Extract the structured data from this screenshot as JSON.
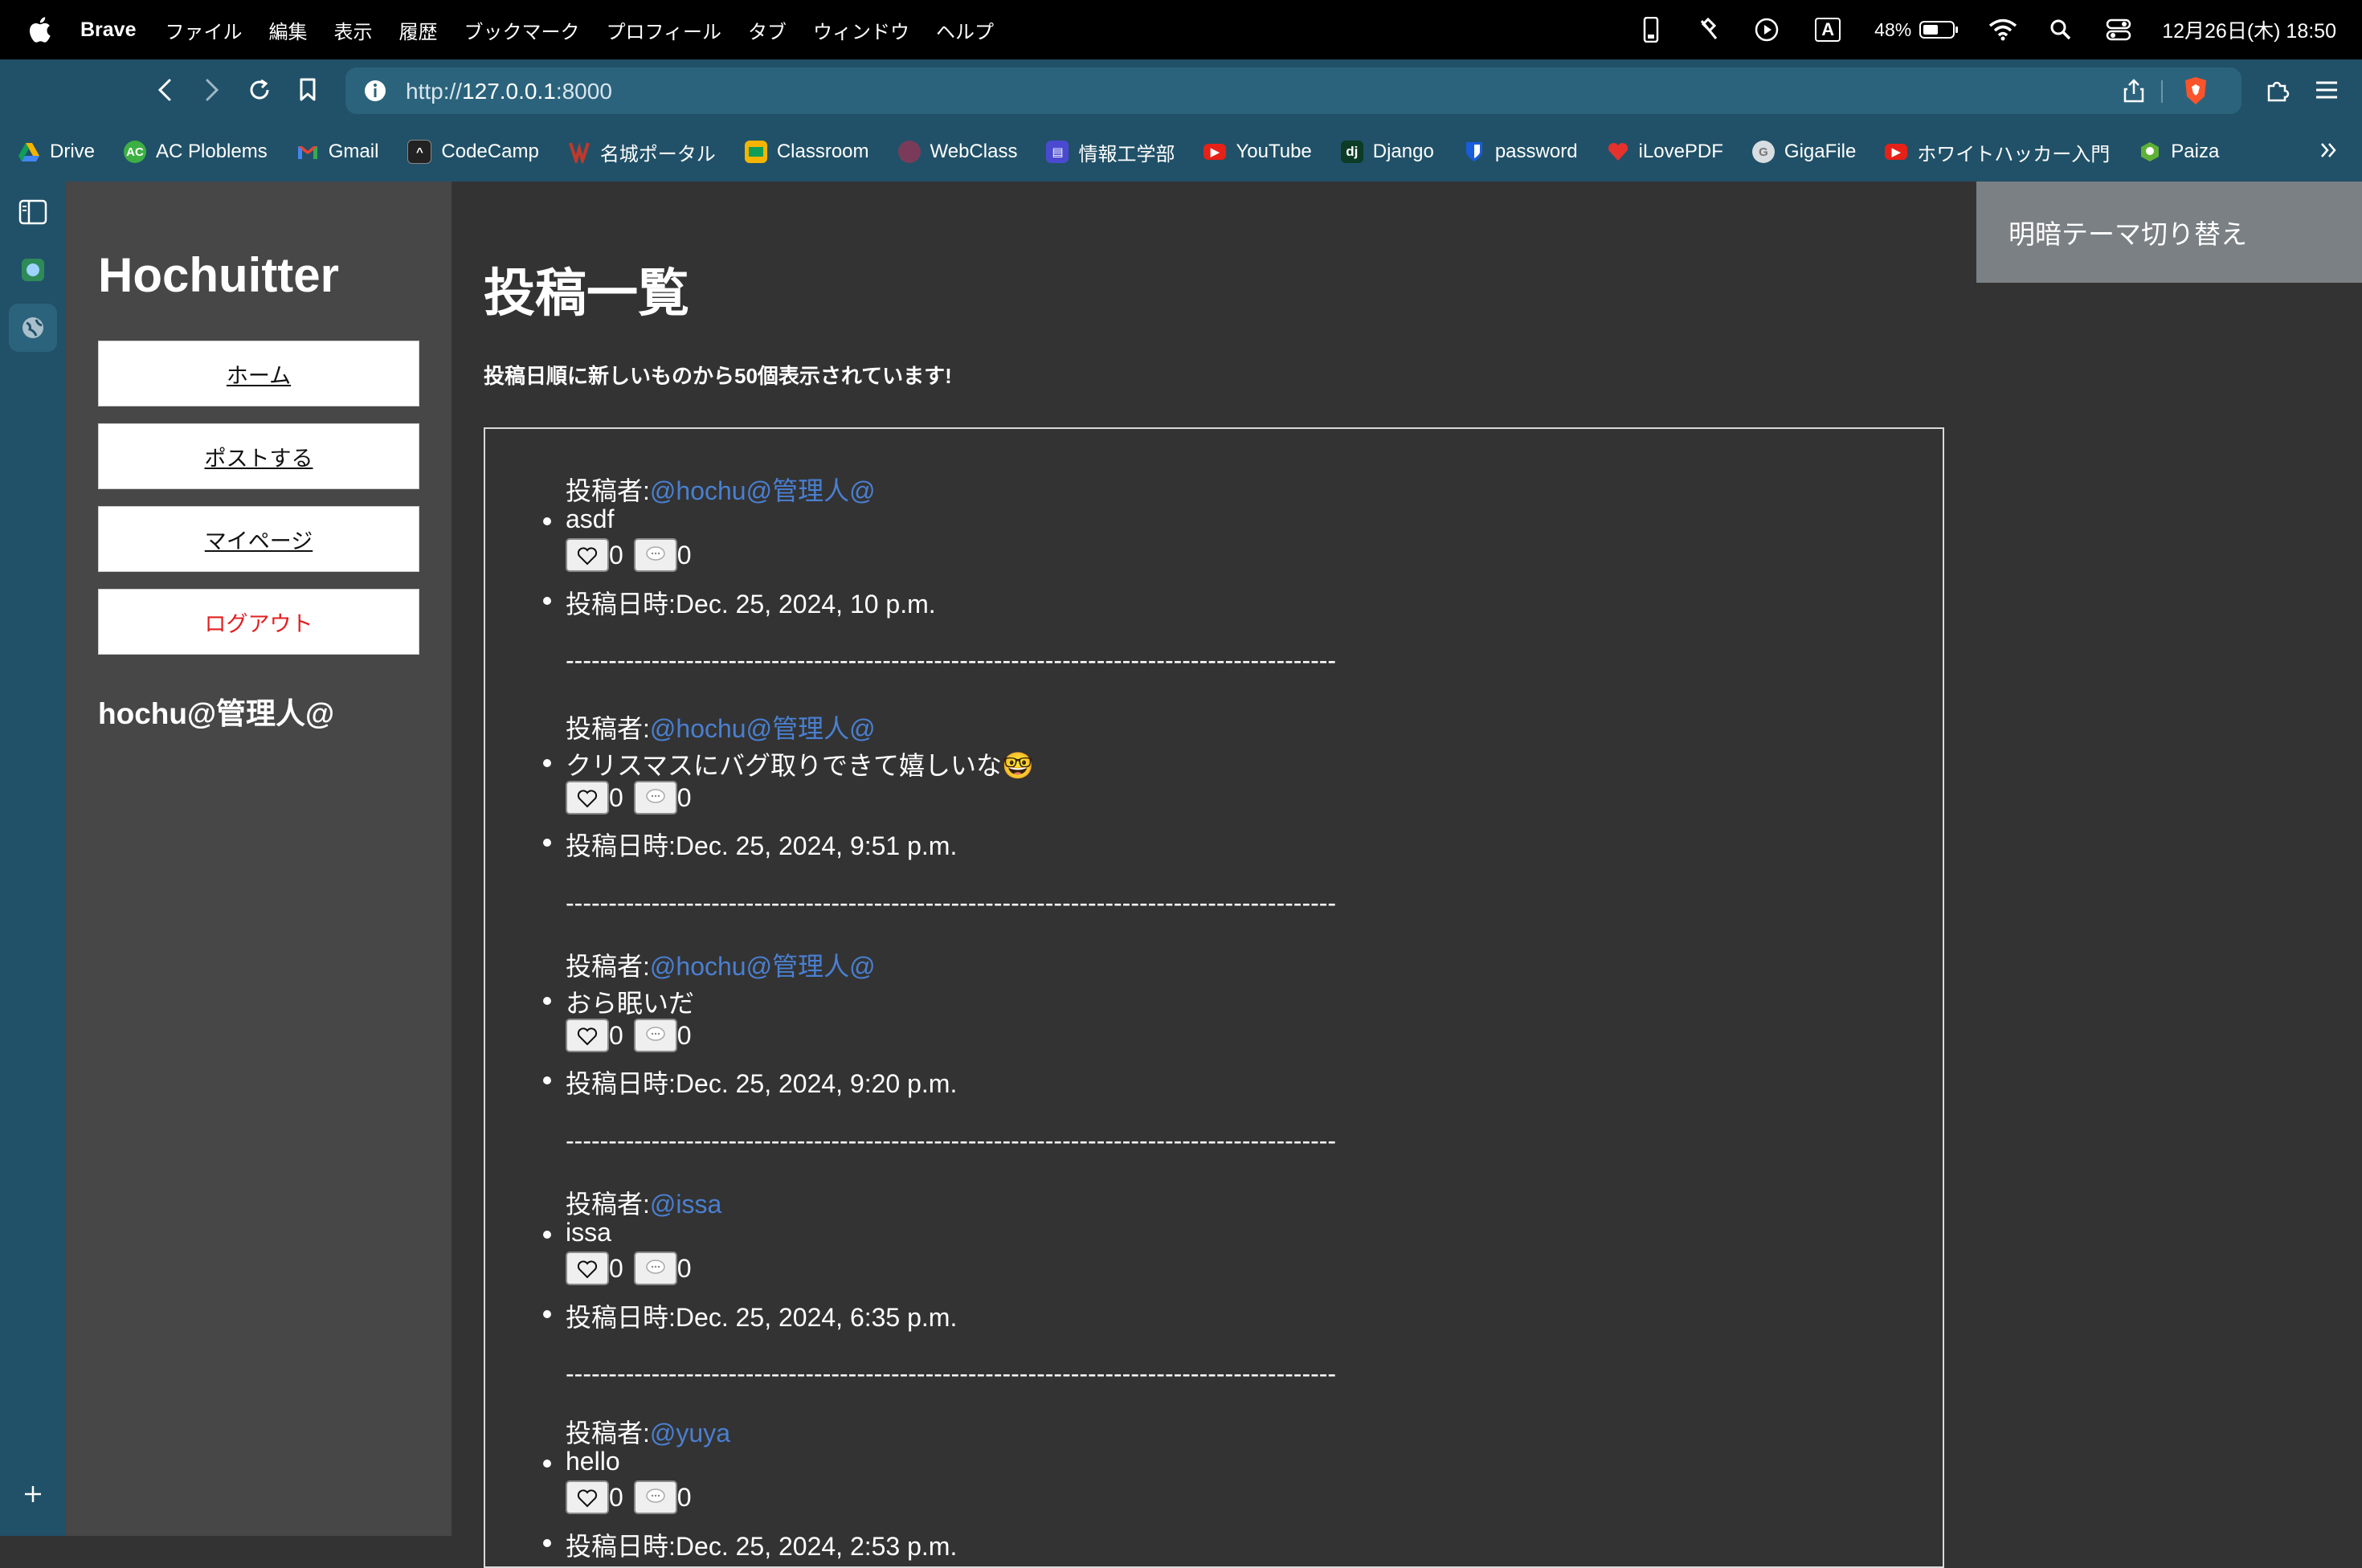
{
  "menubar": {
    "app_name": "Brave",
    "menus": [
      "ファイル",
      "編集",
      "表示",
      "履歴",
      "ブックマーク",
      "プロフィール",
      "タブ",
      "ウィンドウ",
      "ヘルプ"
    ],
    "battery": "48%",
    "datetime": "12月26日(木) 18:50",
    "input_indicator": "A"
  },
  "browser": {
    "url_prefix": "http://",
    "url_host": "127.0.0.1",
    "url_port": ":8000",
    "bookmarks": [
      {
        "label": "Drive",
        "icon": "drive-icon",
        "color": "#4285f4"
      },
      {
        "label": "AC Ploblems",
        "icon": "ac-icon",
        "color": "#3cb043"
      },
      {
        "label": "Gmail",
        "icon": "gmail-icon",
        "color": "#ea4335"
      },
      {
        "label": "CodeCamp",
        "icon": "codecamp-icon",
        "color": "#222222"
      },
      {
        "label": "名城ポータル",
        "icon": "meijo-icon",
        "color": "#c0392b"
      },
      {
        "label": "Classroom",
        "icon": "classroom-icon",
        "color": "#f4b400"
      },
      {
        "label": "WebClass",
        "icon": "webclass-icon",
        "color": "#7a3b5a"
      },
      {
        "label": "情報工学部",
        "icon": "info-eng-icon",
        "color": "#4a4ad0"
      },
      {
        "label": "YouTube",
        "icon": "youtube-icon",
        "color": "#e62117"
      },
      {
        "label": "Django",
        "icon": "django-icon",
        "color": "#0c3c26"
      },
      {
        "label": "password",
        "icon": "bitwarden-icon",
        "color": "#175ddc"
      },
      {
        "label": "iLovePDF",
        "icon": "ilovepdf-icon",
        "color": "#e5322d"
      },
      {
        "label": "GigaFile",
        "icon": "gigafile-icon",
        "color": "#9aa0a6"
      },
      {
        "label": "ホワイトハッカー入門",
        "icon": "youtube-icon",
        "color": "#e62117"
      },
      {
        "label": "Paiza",
        "icon": "paiza-icon",
        "color": "#5fb135"
      }
    ]
  },
  "site": {
    "title": "Hochuitter",
    "nav": {
      "home": "ホーム",
      "post": "ポストする",
      "mypage": "マイページ",
      "logout": "ログアウト"
    },
    "username": "hochu@管理人@",
    "theme_toggle": "明暗テーマ切り替え",
    "main_title": "投稿一覧",
    "subtitle": "投稿日順に新しいものから50個表示されています!",
    "author_label": "投稿者:",
    "date_label": "投稿日時:",
    "divider": "------------------------------------------------------------------------------------------"
  },
  "posts": [
    {
      "author": "@hochu@管理人@",
      "content": "asdf",
      "likes": "0",
      "comments": "0",
      "date": "Dec. 25, 2024, 10 p.m."
    },
    {
      "author": "@hochu@管理人@",
      "content": "クリスマスにバグ取りできて嬉しいな🤓",
      "likes": "0",
      "comments": "0",
      "date": "Dec. 25, 2024, 9:51 p.m."
    },
    {
      "author": "@hochu@管理人@",
      "content": "おら眠いだ",
      "likes": "0",
      "comments": "0",
      "date": "Dec. 25, 2024, 9:20 p.m."
    },
    {
      "author": "@issa",
      "content": "issa",
      "likes": "0",
      "comments": "0",
      "date": "Dec. 25, 2024, 6:35 p.m."
    },
    {
      "author": "@yuya",
      "content": "hello",
      "likes": "0",
      "comments": "0",
      "date": "Dec. 25, 2024, 2:53 p.m."
    }
  ],
  "colors": {
    "link": "#4a7fd0",
    "logout": "#e02020",
    "toolbar": "#215168",
    "page_bg": "#333333",
    "left_panel": "#474747"
  }
}
